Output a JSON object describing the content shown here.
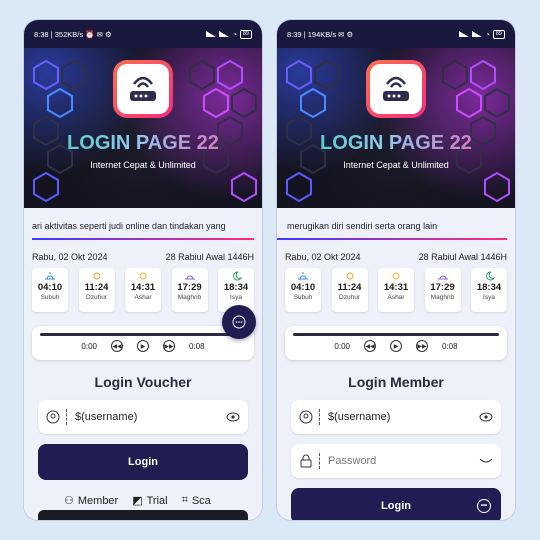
{
  "phones": [
    {
      "status_bar": {
        "time": "8:38",
        "speed": "352KB/s",
        "battery": "89"
      },
      "banner": {
        "title": "LOGIN PAGE 22",
        "subtitle": "Internet Cepat & Unlimited"
      },
      "marquee": "ari aktivitas seperti judi online dan tindakan yang",
      "date": {
        "gregorian": "Rabu, 02 Okt 2024",
        "hijri": "28 Rabiul Awal 1446H"
      },
      "prayers": [
        {
          "time": "04:10",
          "name": "Subuh"
        },
        {
          "time": "11:24",
          "name": "Dzuhur"
        },
        {
          "time": "14:31",
          "name": "Ashar"
        },
        {
          "time": "17:29",
          "name": "Maghrib"
        },
        {
          "time": "18:34",
          "name": "Isya"
        }
      ],
      "player": {
        "current": "0:00",
        "duration": "0:08"
      },
      "form_title": "Login Voucher",
      "username_value": "$(username)",
      "login_label": "Login",
      "links": [
        "Member",
        "Trial",
        "Sca"
      ]
    },
    {
      "status_bar": {
        "time": "8:39",
        "speed": "194KB/s",
        "battery": "89"
      },
      "banner": {
        "title": "LOGIN PAGE 22",
        "subtitle": "Internet Cepat & Unlimited"
      },
      "marquee": "merugikan diri sendiri serta orang lain",
      "date": {
        "gregorian": "Rabu, 02 Okt 2024",
        "hijri": "28 Rabiul Awal 1446H"
      },
      "prayers": [
        {
          "time": "04:10",
          "name": "Subuh"
        },
        {
          "time": "11:24",
          "name": "Dzuhur"
        },
        {
          "time": "14:31",
          "name": "Ashar"
        },
        {
          "time": "17:29",
          "name": "Maghrib"
        },
        {
          "time": "18:34",
          "name": "Isya"
        }
      ],
      "player": {
        "current": "0:00",
        "duration": "0:08"
      },
      "form_title": "Login Member",
      "username_value": "$(username)",
      "password_placeholder": "Password",
      "login_label": "Login"
    }
  ],
  "colors": {
    "accent": "#211d52",
    "background": "#dbe8f5",
    "title_gradient": [
      "#3cd1a7",
      "#f05aa8"
    ]
  },
  "icons": [
    "router-icon",
    "user-icon",
    "eye-icon",
    "lock-icon",
    "chat-icon",
    "play-icon",
    "rewind-icon",
    "forward-icon"
  ]
}
